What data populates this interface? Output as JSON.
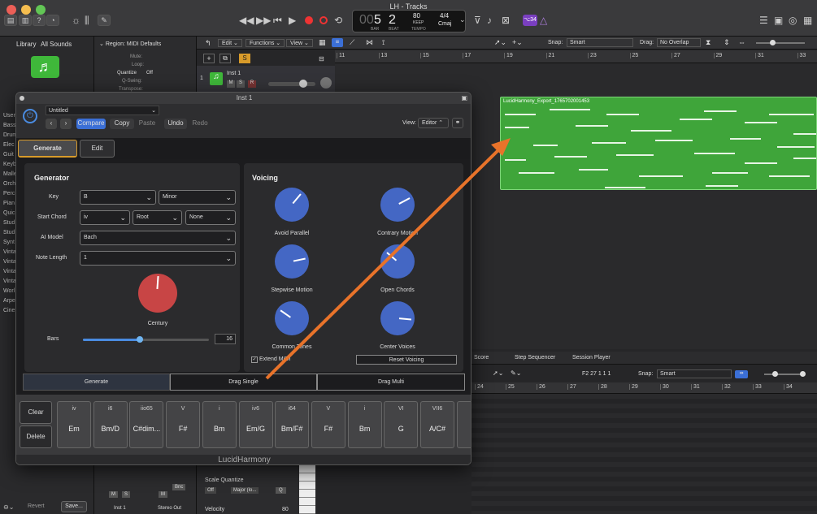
{
  "window": {
    "title": "LH - Tracks"
  },
  "lcd": {
    "bar": "5",
    "beat": "2",
    "bar_label": "BAR",
    "beat_label": "BEAT",
    "tempo": "80",
    "keep": "KEEP",
    "tempo_label": "TEMPO",
    "sig": "4/4",
    "key": "Cmaj",
    "prefix": "00"
  },
  "badge": "⌥34",
  "library": {
    "title": "Library",
    "all_sounds": "All Sounds",
    "items": [
      "User",
      "Bass",
      "Drum",
      "Elec",
      "Guit",
      "Keyb",
      "Malle",
      "Orch",
      "Perc",
      "Pian",
      "Quic",
      "Stud",
      "Stud",
      "Synt",
      "Vinta",
      "Vinta",
      "Vinta",
      "Vinta",
      "Worl",
      "Arpe",
      "Cine"
    ],
    "revert": "Revert",
    "save": "Save..."
  },
  "inspector": {
    "region": "Region: MIDI Defaults",
    "mute": "Mute:",
    "loop": "Loop:",
    "quantize": "Quantize",
    "quantize_val": "Off",
    "qswing": "Q-Swing:",
    "transpose": "Transpose:",
    "ch1": "Inst 1",
    "ch2": "Stereo Out",
    "m": "M",
    "s": "S",
    "bnc": "Bnc"
  },
  "tracks": {
    "edit": "Edit",
    "functions": "Functions",
    "view": "View",
    "snap_label": "Snap:",
    "snap": "Smart",
    "drag_label": "Drag:",
    "drag": "No Overlap",
    "track_num": "1",
    "track_name": "Inst 1",
    "s": "S",
    "ruler": [
      "11",
      "13",
      "15",
      "17",
      "19",
      "21",
      "23",
      "25",
      "27",
      "29",
      "31",
      "33"
    ],
    "region": "LucidHarmony_Export_1765702001453"
  },
  "pianoroll": {
    "tabs": [
      "Score",
      "Step Sequencer",
      "Session Player"
    ],
    "pos": "F2  27 1 1 1",
    "snap_label": "Snap:",
    "snap": "Smart",
    "ruler": [
      "24",
      "25",
      "26",
      "27",
      "28",
      "29",
      "30",
      "31",
      "32",
      "33",
      "34"
    ],
    "scale_q": "Scale Quantize",
    "sq_off": "Off",
    "sq_major": "Major (lo...",
    "q": "Q",
    "velocity": "Velocity",
    "velocity_val": "80"
  },
  "plugin": {
    "title": "Inst 1",
    "preset": "Untitled",
    "compare": "Compare",
    "copy": "Copy",
    "paste": "Paste",
    "undo": "Undo",
    "redo": "Redo",
    "view_label": "View:",
    "view": "Editor",
    "tabs": [
      "Generate",
      "Edit"
    ],
    "generator": {
      "title": "Generator",
      "key_label": "Key",
      "key": "B",
      "mode": "Minor",
      "start_label": "Start Chord",
      "start": "iv",
      "root": "Root",
      "none": "None",
      "model_label": "AI Model",
      "model": "Bach",
      "len_label": "Note Length",
      "len": "1",
      "knob_label": "Century",
      "bars_label": "Bars",
      "bars": "16",
      "bars_fraction": 0.45
    },
    "voicing": {
      "title": "Voicing",
      "knobs": [
        "Avoid Parallel",
        "Contrary Motion",
        "Stepwise Motion",
        "Open Chords",
        "Common Tones",
        "Center Voices"
      ],
      "extend": "Extend MIDI",
      "reset": "Reset Voicing"
    },
    "actions": {
      "generate": "Generate",
      "drag_single": "Drag Single",
      "drag_multi": "Drag Multi"
    },
    "clear": "Clear",
    "delete": "Delete",
    "chords": [
      {
        "r": "iv",
        "n": "Em"
      },
      {
        "r": "i6",
        "n": "Bm/D"
      },
      {
        "r": "iio65",
        "n": "C#dim..."
      },
      {
        "r": "V",
        "n": "F#"
      },
      {
        "r": "i",
        "n": "Bm"
      },
      {
        "r": "iv6",
        "n": "Em/G"
      },
      {
        "r": "i64",
        "n": "Bm/F#"
      },
      {
        "r": "V",
        "n": "F#"
      },
      {
        "r": "i",
        "n": "Bm"
      },
      {
        "r": "VI",
        "n": "G"
      },
      {
        "r": "VII6",
        "n": "A/C#"
      }
    ],
    "brand": "LucidHarmony"
  },
  "colors": {
    "region": "#3fa53a",
    "accent": "#4467c4",
    "knob_red": "#c84545",
    "arrow": "#e8732a"
  }
}
